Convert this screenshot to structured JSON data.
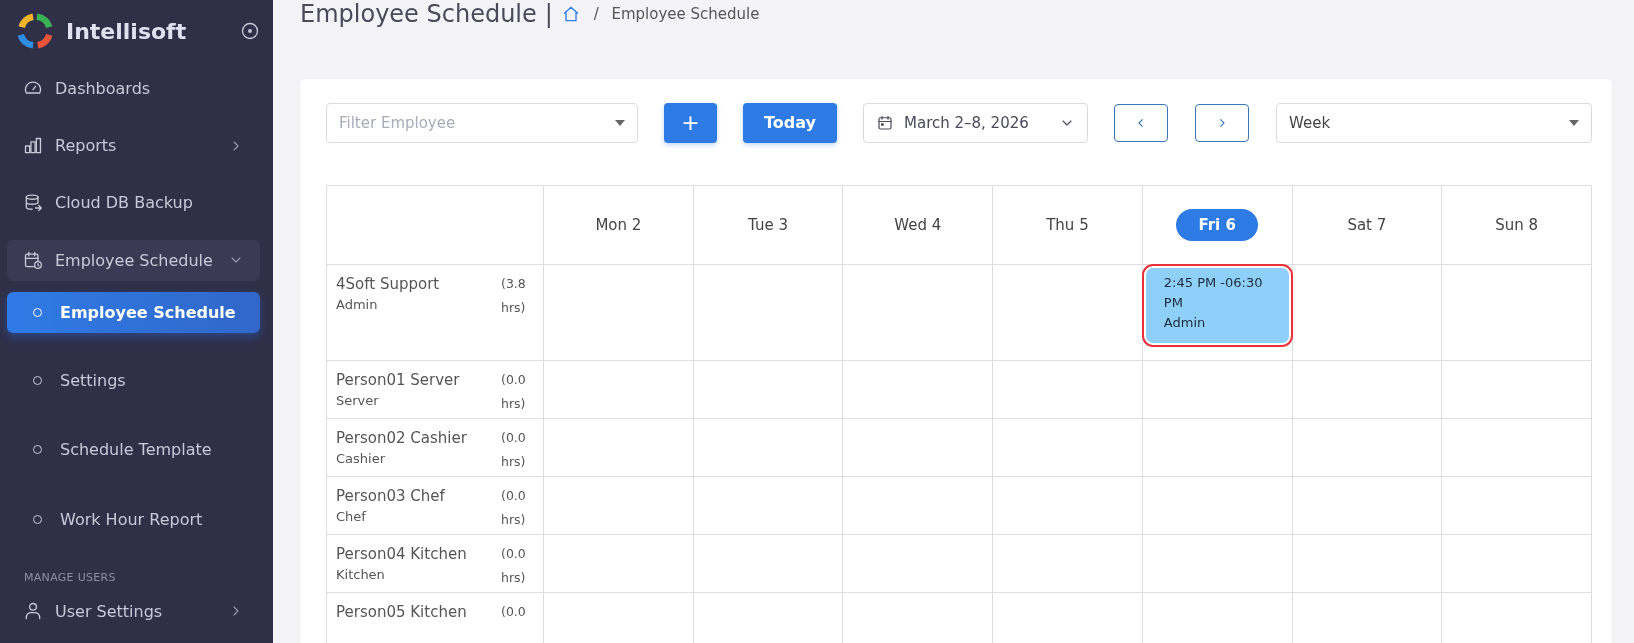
{
  "sidebar": {
    "brand": "Intellisoft",
    "nav": [
      {
        "label": "Dashboards"
      },
      {
        "label": "Reports",
        "expanded": false
      },
      {
        "label": "Cloud DB Backup"
      },
      {
        "label": "Employee Schedule",
        "expanded": true,
        "children": [
          {
            "label": "Employee Schedule",
            "selected": true
          },
          {
            "label": "Settings",
            "selected": false
          },
          {
            "label": "Schedule Template",
            "selected": false
          },
          {
            "label": "Work Hour Report",
            "selected": false
          }
        ]
      }
    ],
    "section_label": "MANAGE USERS",
    "section_nav": [
      {
        "label": "User Settings",
        "expanded": false
      }
    ]
  },
  "header": {
    "title": "Employee Schedule",
    "separator": "|",
    "breadcrumb_divider": "/",
    "breadcrumb": "Employee Schedule"
  },
  "toolbar": {
    "filter_placeholder": "Filter Employee",
    "add_button": "+",
    "today_button": "Today",
    "date_range": "March 2–8, 2026",
    "view": "Week"
  },
  "schedule": {
    "days": [
      {
        "label": "Mon 2",
        "today": false
      },
      {
        "label": "Tue 3",
        "today": false
      },
      {
        "label": "Wed 4",
        "today": false
      },
      {
        "label": "Thu 5",
        "today": false
      },
      {
        "label": "Fri 6",
        "today": true
      },
      {
        "label": "Sat 7",
        "today": false
      },
      {
        "label": "Sun 8",
        "today": false
      }
    ],
    "rows": [
      {
        "name": "4Soft Support",
        "role": "Admin",
        "hours": "(3.8 hrs)",
        "cells": [
          {},
          {},
          {},
          {},
          {
            "time": "2:45 PM -06:30 PM",
            "role": "Admin",
            "highlighted": true
          },
          {},
          {}
        ]
      },
      {
        "name": "Person01 Server",
        "role": "Server",
        "hours": "(0.0 hrs)",
        "cells": [
          {},
          {},
          {},
          {},
          {},
          {},
          {}
        ]
      },
      {
        "name": "Person02 Cashier",
        "role": "Cashier",
        "hours": "(0.0 hrs)",
        "cells": [
          {},
          {},
          {},
          {},
          {},
          {},
          {}
        ]
      },
      {
        "name": "Person03 Chef",
        "role": "Chef",
        "hours": "(0.0 hrs)",
        "cells": [
          {},
          {},
          {},
          {},
          {},
          {},
          {}
        ]
      },
      {
        "name": "Person04 Kitchen",
        "role": "Kitchen",
        "hours": "(0.0 hrs)",
        "cells": [
          {},
          {},
          {},
          {},
          {},
          {},
          {}
        ]
      },
      {
        "name": "Person05 Kitchen",
        "hours": "(0.0",
        "cells": [
          {},
          {},
          {},
          {},
          {},
          {},
          {}
        ]
      }
    ]
  }
}
